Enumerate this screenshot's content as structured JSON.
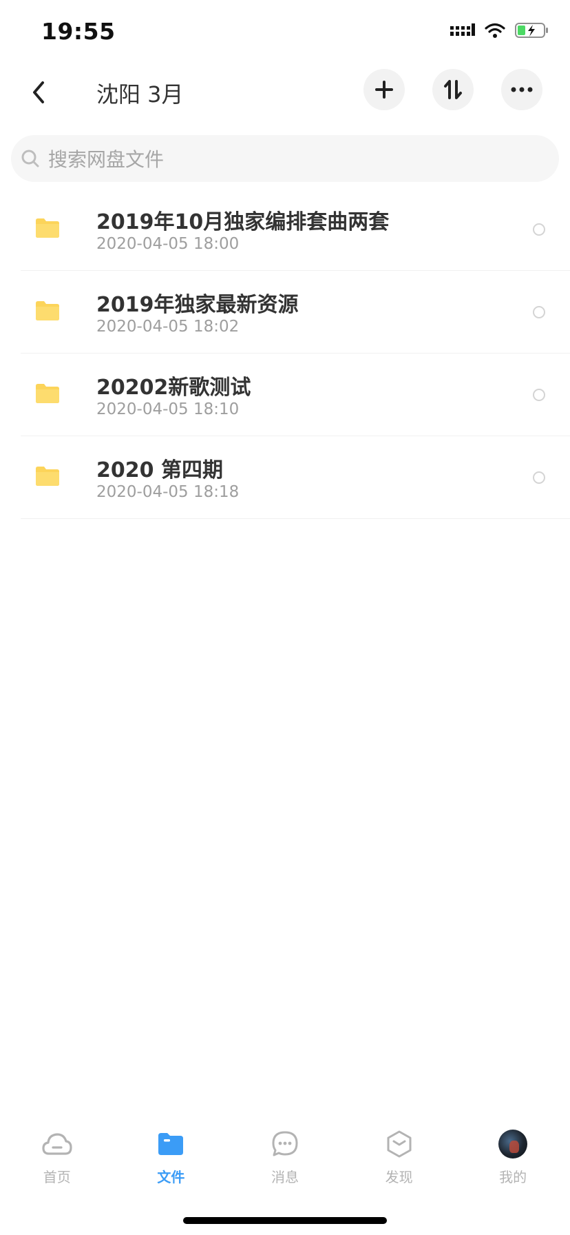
{
  "status_bar": {
    "time": "19:55"
  },
  "header": {
    "title": "沈阳 3月"
  },
  "search": {
    "placeholder": "搜索网盘文件",
    "value": ""
  },
  "files": [
    {
      "name": "2019年10月独家编排套曲两套",
      "date": "2020-04-05 18:00"
    },
    {
      "name": "2019年独家最新资源",
      "date": "2020-04-05 18:02"
    },
    {
      "name": "20202新歌测试",
      "date": "2020-04-05 18:10"
    },
    {
      "name": "2020 第四期",
      "date": "2020-04-05 18:18"
    }
  ],
  "tabs": [
    {
      "label": "首页",
      "icon": "cloud-icon"
    },
    {
      "label": "文件",
      "icon": "folder-icon",
      "active": true
    },
    {
      "label": "消息",
      "icon": "chat-bubble-icon"
    },
    {
      "label": "发现",
      "icon": "hexagon-icon"
    },
    {
      "label": "我的",
      "icon": "avatar"
    }
  ],
  "colors": {
    "accent": "#3b9cf6",
    "folder": "#fcd45a",
    "battery": "#4cd964"
  }
}
